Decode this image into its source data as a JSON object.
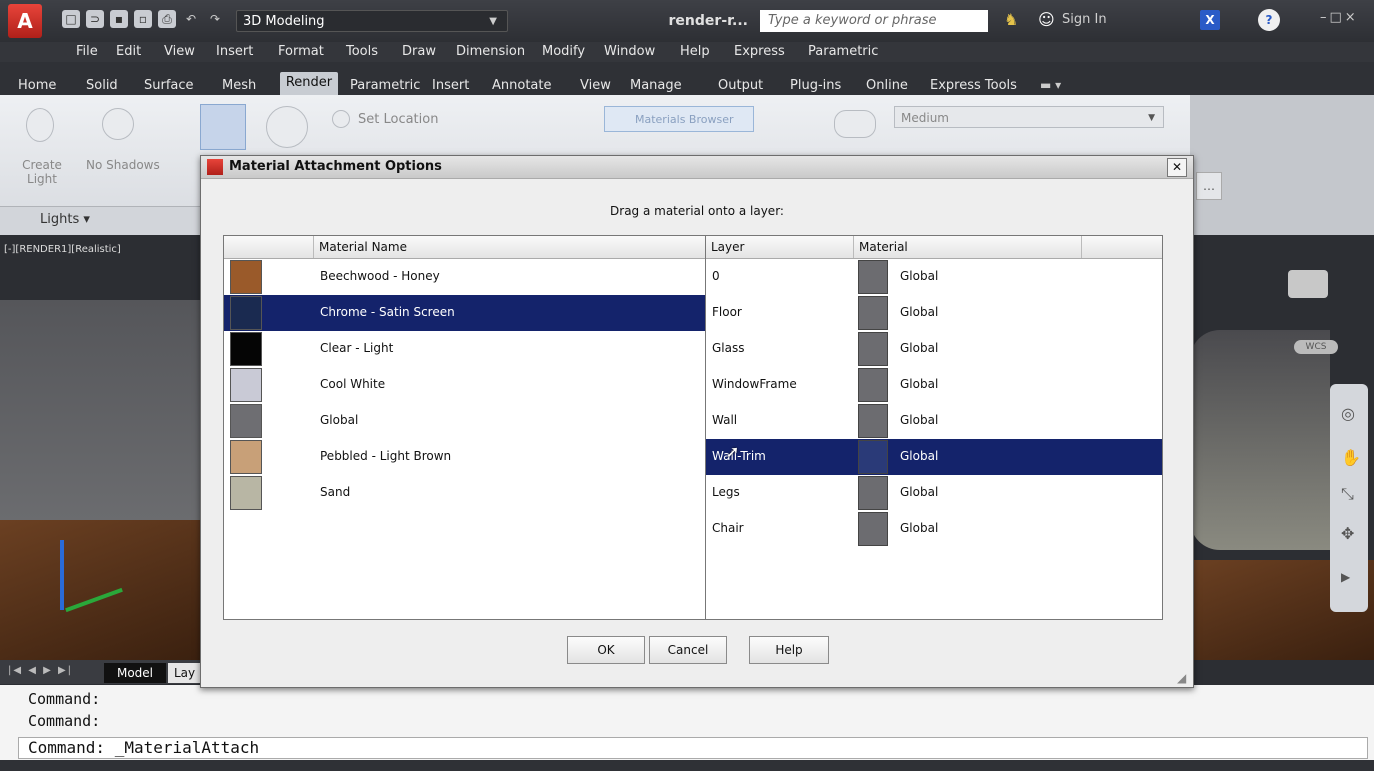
{
  "titlebar": {
    "workspace": "3D Modeling",
    "doc_title": "render-r...",
    "search_placeholder": "Type a keyword or phrase",
    "signin": "Sign In"
  },
  "menubar": [
    "File",
    "Edit",
    "View",
    "Insert",
    "Format",
    "Tools",
    "Draw",
    "Dimension",
    "Modify",
    "Window",
    "Help",
    "Express",
    "Parametric"
  ],
  "ribbon_tabs": [
    "Home",
    "Solid",
    "Surface",
    "Mesh",
    "Render",
    "Parametric",
    "Insert",
    "Annotate",
    "View",
    "Manage",
    "Output",
    "Plug-ins",
    "Online",
    "Express Tools"
  ],
  "ribbon_active_tab": "Render",
  "ribbon": {
    "create_light": "Create Light",
    "no_shadows": "No Shadows",
    "set_location": "Set Location",
    "materials_browser": "Materials Browser",
    "render_quality": "Medium",
    "lights_panel": "Lights"
  },
  "viewport": {
    "label": "[-][RENDER1][Realistic]",
    "wcs": "WCS"
  },
  "layout_tabs": {
    "model": "Model",
    "layout": "Lay"
  },
  "command": {
    "lines": [
      "Command:",
      "Command:"
    ],
    "current": "Command:  _MaterialAttach"
  },
  "dialog": {
    "title": "Material Attachment Options",
    "instruction": "Drag a material onto a layer:",
    "materials_header": "Material Name",
    "materials": [
      {
        "name": "Beechwood - Honey",
        "swatch": "#9a5a2a"
      },
      {
        "name": "Chrome - Satin Screen",
        "swatch": "#1a2a50",
        "selected": true
      },
      {
        "name": "Clear - Light",
        "swatch": "#050505"
      },
      {
        "name": "Cool White",
        "swatch": "#c9cad6"
      },
      {
        "name": "Global",
        "swatch": "#6e6e72"
      },
      {
        "name": "Pebbled - Light Brown",
        "swatch": "#c8a078"
      },
      {
        "name": "Sand",
        "swatch": "#b8b6a4"
      }
    ],
    "layer_header": "Layer",
    "material_header": "Material",
    "layers": [
      {
        "layer": "0",
        "material": "Global"
      },
      {
        "layer": "Floor",
        "material": "Global"
      },
      {
        "layer": "Glass",
        "material": "Global"
      },
      {
        "layer": "WindowFrame",
        "material": "Global"
      },
      {
        "layer": "Wall",
        "material": "Global"
      },
      {
        "layer": "Wall-Trim",
        "material": "Global",
        "selected": true
      },
      {
        "layer": "Legs",
        "material": "Global"
      },
      {
        "layer": "Chair",
        "material": "Global"
      }
    ],
    "ok": "OK",
    "cancel": "Cancel",
    "help": "Help"
  }
}
